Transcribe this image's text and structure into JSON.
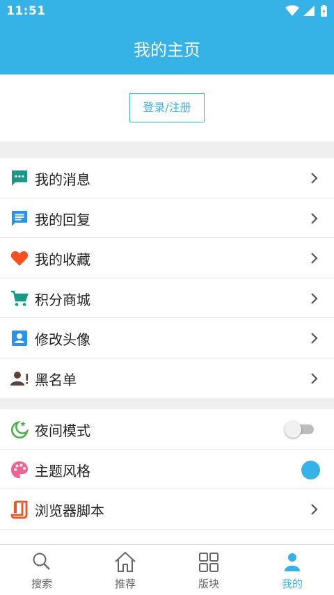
{
  "status_bar": {
    "time": "11:51"
  },
  "app_bar": {
    "title": "我的主页"
  },
  "login": {
    "label": "登录/注册"
  },
  "menu_group_1": [
    {
      "label": "我的消息",
      "icon": "message-icon",
      "color": "#1a9a86"
    },
    {
      "label": "我的回复",
      "icon": "reply-icon",
      "color": "#2a93e6"
    },
    {
      "label": "我的收藏",
      "icon": "heart-icon",
      "color": "#f4511e"
    },
    {
      "label": "积分商城",
      "icon": "cart-icon",
      "color": "#1a9a86"
    },
    {
      "label": "修改头像",
      "icon": "avatar-icon",
      "color": "#2a93e6"
    },
    {
      "label": "黑名单",
      "icon": "block-user-icon",
      "color": "#5d4037"
    }
  ],
  "menu_group_2": [
    {
      "label": "夜间模式",
      "icon": "night-mode-icon",
      "color": "#4caf50",
      "control": "toggle",
      "value": false
    },
    {
      "label": "主题风格",
      "icon": "palette-icon",
      "color": "#f06292",
      "control": "color",
      "value": "#35b3e6"
    },
    {
      "label": "浏览器脚本",
      "icon": "script-icon",
      "color": "#f4511e",
      "control": "chevron"
    }
  ],
  "tabs": [
    {
      "label": "搜索",
      "icon": "search-icon",
      "active": false
    },
    {
      "label": "推荐",
      "icon": "home-icon",
      "active": false
    },
    {
      "label": "版块",
      "icon": "grid-icon",
      "active": false
    },
    {
      "label": "我的",
      "icon": "person-icon",
      "active": true
    }
  ],
  "colors": {
    "accent": "#35b3e6",
    "inactive": "#666666"
  }
}
